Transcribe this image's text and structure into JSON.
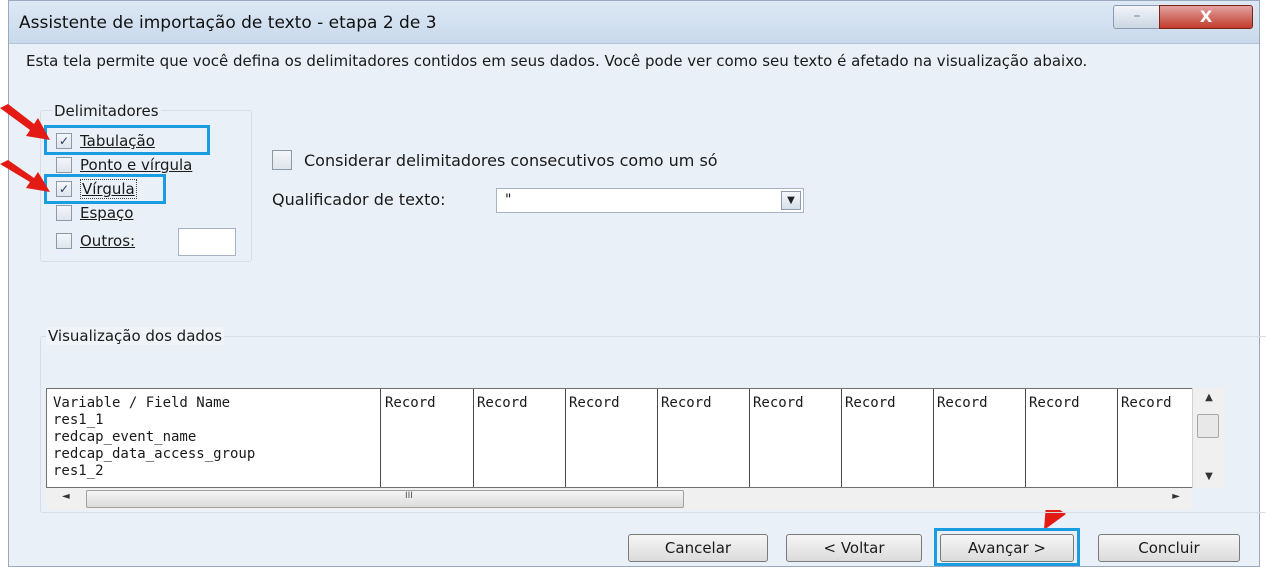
{
  "window": {
    "title": "Assistente de importação de texto - etapa 2 de 3",
    "close_glyph": "X",
    "min_glyph": "□ 🗕"
  },
  "description": "Esta tela permite que você defina os delimitadores contidos em seus dados. Você pode ver como seu texto é afetado na visualização abaixo.",
  "delimiters": {
    "group_label": "Delimitadores",
    "items": [
      {
        "label": "Tabulação",
        "checked": true,
        "mark": "✓"
      },
      {
        "label": "Ponto e vírgula",
        "checked": false,
        "mark": ""
      },
      {
        "label": "Vírgula",
        "checked": true,
        "mark": "✓"
      },
      {
        "label": "Espaço",
        "checked": false,
        "mark": ""
      },
      {
        "label": "Outros:",
        "checked": false,
        "mark": ""
      }
    ],
    "outros_value": ""
  },
  "options": {
    "consecutive_label": "Considerar delimitadores consecutivos como um só",
    "qualifier_label": "Qualificador de texto:",
    "qualifier_value": "\"",
    "dropdown_glyph": "▼"
  },
  "preview": {
    "label": "Visualização dos dados",
    "first_column": [
      "Variable / Field Name",
      "res1_1",
      "redcap_event_name",
      "redcap_data_access_group",
      "res1_2"
    ],
    "record_header": "Record",
    "scroll_up": "▲",
    "scroll_down": "▼",
    "scroll_left": "◄",
    "scroll_right": "►",
    "grip": "III"
  },
  "buttons": {
    "cancel": "Cancelar",
    "back": "< Voltar",
    "next": "Avançar >",
    "finish": "Concluir"
  },
  "colors": {
    "highlight": "#1a9de0",
    "arrow": "#e31b14"
  }
}
